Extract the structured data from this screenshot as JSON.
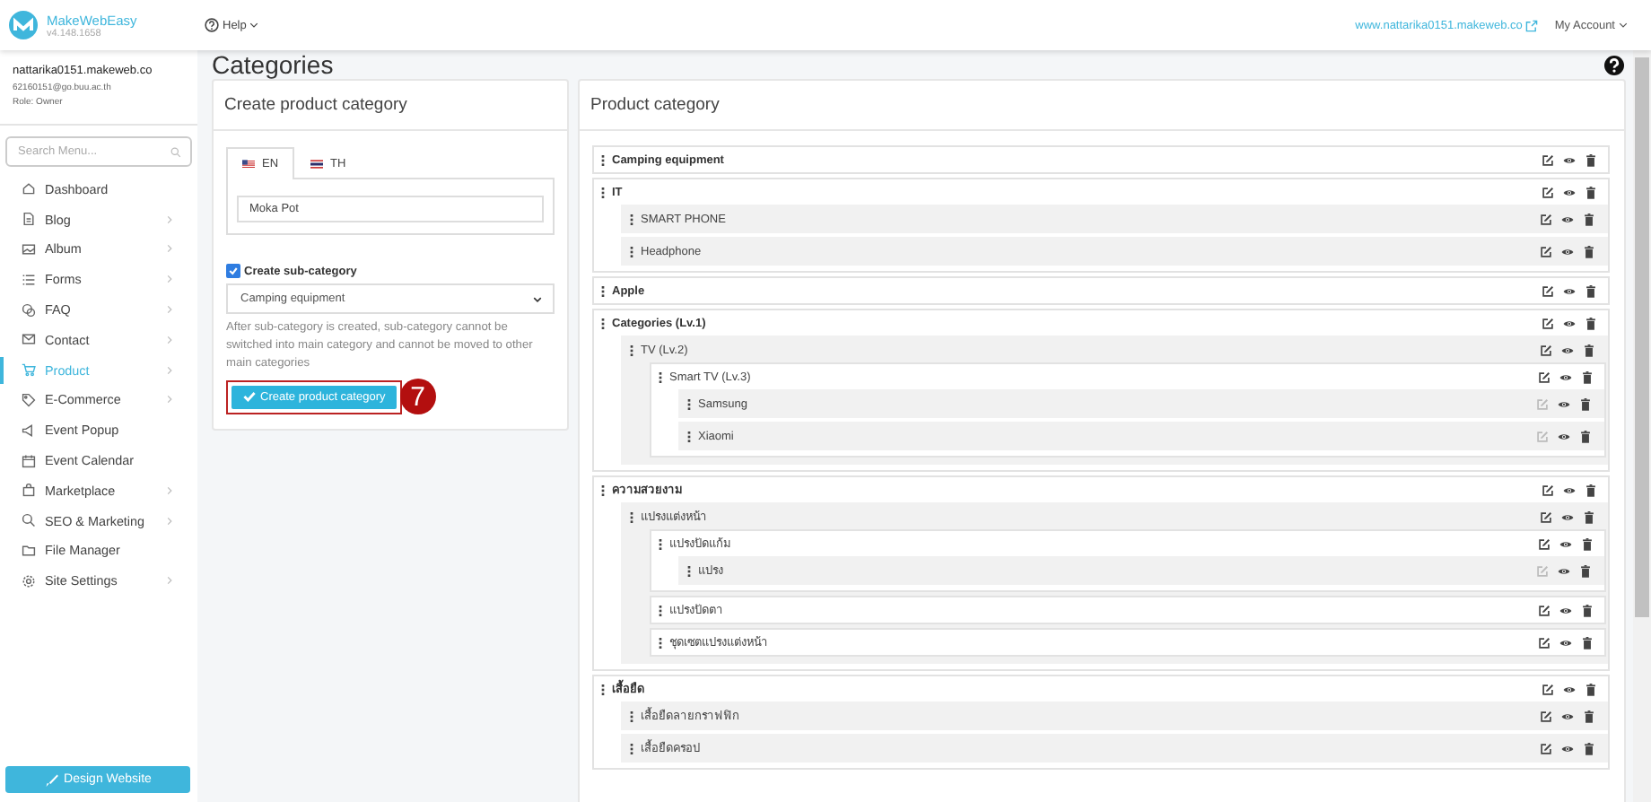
{
  "app": {
    "name": "MakeWebEasy",
    "version": "v4.148.1658"
  },
  "topbar": {
    "help": "Help",
    "site_link": "www.nattarika0151.makeweb.co",
    "account": "My Account"
  },
  "user": {
    "site": "nattarika0151.makeweb.co",
    "email": "62160151@go.buu.ac.th",
    "role": "Role: Owner"
  },
  "sidebar": {
    "search_placeholder": "Search Menu...",
    "items": [
      {
        "label": "Dashboard",
        "submenu": false,
        "selected": false
      },
      {
        "label": "Blog",
        "submenu": true,
        "selected": false
      },
      {
        "label": "Album",
        "submenu": true,
        "selected": false
      },
      {
        "label": "Forms",
        "submenu": true,
        "selected": false
      },
      {
        "label": "FAQ",
        "submenu": true,
        "selected": false
      },
      {
        "label": "Contact",
        "submenu": true,
        "selected": false
      },
      {
        "label": "Product",
        "submenu": true,
        "selected": true
      },
      {
        "label": "E-Commerce",
        "submenu": true,
        "selected": false
      },
      {
        "label": "Event Popup",
        "submenu": false,
        "selected": false
      },
      {
        "label": "Event Calendar",
        "submenu": false,
        "selected": false
      },
      {
        "label": "Marketplace",
        "submenu": true,
        "selected": false
      },
      {
        "label": "SEO & Marketing",
        "submenu": true,
        "selected": false
      },
      {
        "label": "File Manager",
        "submenu": false,
        "selected": false
      },
      {
        "label": "Site Settings",
        "submenu": true,
        "selected": false
      }
    ],
    "design_button": "Design Website"
  },
  "page_title": "Categories",
  "create_card": {
    "title": "Create product category",
    "tabs": [
      {
        "label": "EN",
        "selected": true
      },
      {
        "label": "TH",
        "selected": false
      }
    ],
    "name_value": "Moka Pot",
    "subcategory": {
      "label": "Create sub-category",
      "checked": true
    },
    "parent_select": "Camping equipment",
    "help_text": "After sub-category is created, sub-category cannot be switched into main category and cannot be moved to other main categories",
    "button": "Create product category",
    "step_badge": "7"
  },
  "category_card": {
    "title": "Product category",
    "tree": [
      {
        "label": "Camping equipment",
        "edit_disabled": false
      },
      {
        "label": "IT",
        "edit_disabled": false,
        "children": [
          {
            "label": "SMART PHONE",
            "edit_disabled": false
          },
          {
            "label": "Headphone",
            "edit_disabled": false
          }
        ]
      },
      {
        "label": "Apple",
        "edit_disabled": false
      },
      {
        "label": "Categories (Lv.1)",
        "edit_disabled": false,
        "children": [
          {
            "label": "TV (Lv.2)",
            "edit_disabled": false,
            "children": [
              {
                "label": "Smart TV (Lv.3)",
                "edit_disabled": false,
                "children": [
                  {
                    "label": "Samsung",
                    "edit_disabled": true
                  },
                  {
                    "label": "Xiaomi",
                    "edit_disabled": true
                  }
                ]
              }
            ]
          }
        ]
      },
      {
        "label": "ความสวยงาม",
        "edit_disabled": false,
        "children": [
          {
            "label": "แปรงแต่งหน้า",
            "edit_disabled": false,
            "children": [
              {
                "label": "แปรงปัดแก้ม",
                "edit_disabled": false,
                "children": [
                  {
                    "label": "แปรง",
                    "edit_disabled": true
                  }
                ]
              },
              {
                "label": "แปรงปัดตา",
                "edit_disabled": false
              },
              {
                "label": "ชุดเซตแปรงแต่งหน้า",
                "edit_disabled": false
              }
            ]
          }
        ]
      },
      {
        "label": "เสื้อยืด",
        "edit_disabled": false,
        "children": [
          {
            "label": "เสื้อยืดลายกราฟฟิก",
            "edit_disabled": false
          },
          {
            "label": "เสื้อยืดครอป",
            "edit_disabled": false
          }
        ]
      }
    ]
  }
}
